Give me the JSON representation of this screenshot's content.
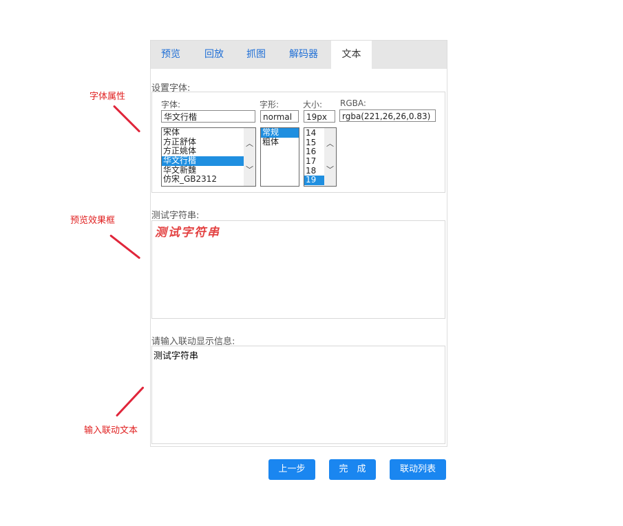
{
  "annotations": {
    "font_props": "字体属性",
    "preview_box": "预览效果框",
    "input_text": "输入联动文本"
  },
  "tabs": [
    "预览",
    "回放",
    "抓图",
    "解码器",
    "文本"
  ],
  "active_tab": "文本",
  "font_section": {
    "label": "设置字体:",
    "font_label": "字体:",
    "font_value": "华文行楷",
    "font_options": [
      "宋体",
      "方正舒体",
      "方正姚体",
      "华文行楷",
      "华文新魏",
      "仿宋_GB2312"
    ],
    "font_selected": "华文行楷",
    "style_label": "字形:",
    "style_value": "normal",
    "style_options": [
      "常规",
      "粗体"
    ],
    "style_selected": "常规",
    "size_label": "大小:",
    "size_value": "19px",
    "size_options": [
      "14",
      "15",
      "16",
      "17",
      "18",
      "19"
    ],
    "size_selected": "19",
    "rgba_label": "RGBA:",
    "rgba_value": "rgba(221,26,26,0.83)",
    "preview_color": "#dd1a1a"
  },
  "test_string_section": {
    "label": "测试字符串:",
    "preview_text": "测试字符串"
  },
  "info_section": {
    "label": "请输入联动显示信息:",
    "value": "测试字符串"
  },
  "buttons": {
    "prev": "上一步",
    "finish": "完　成",
    "link_list": "联动列表"
  },
  "icons": {
    "scroll_up": "chevron-up-icon",
    "scroll_down": "chevron-down-icon"
  },
  "colors": {
    "accent": "#1a86f0",
    "annotation": "#e02020"
  }
}
